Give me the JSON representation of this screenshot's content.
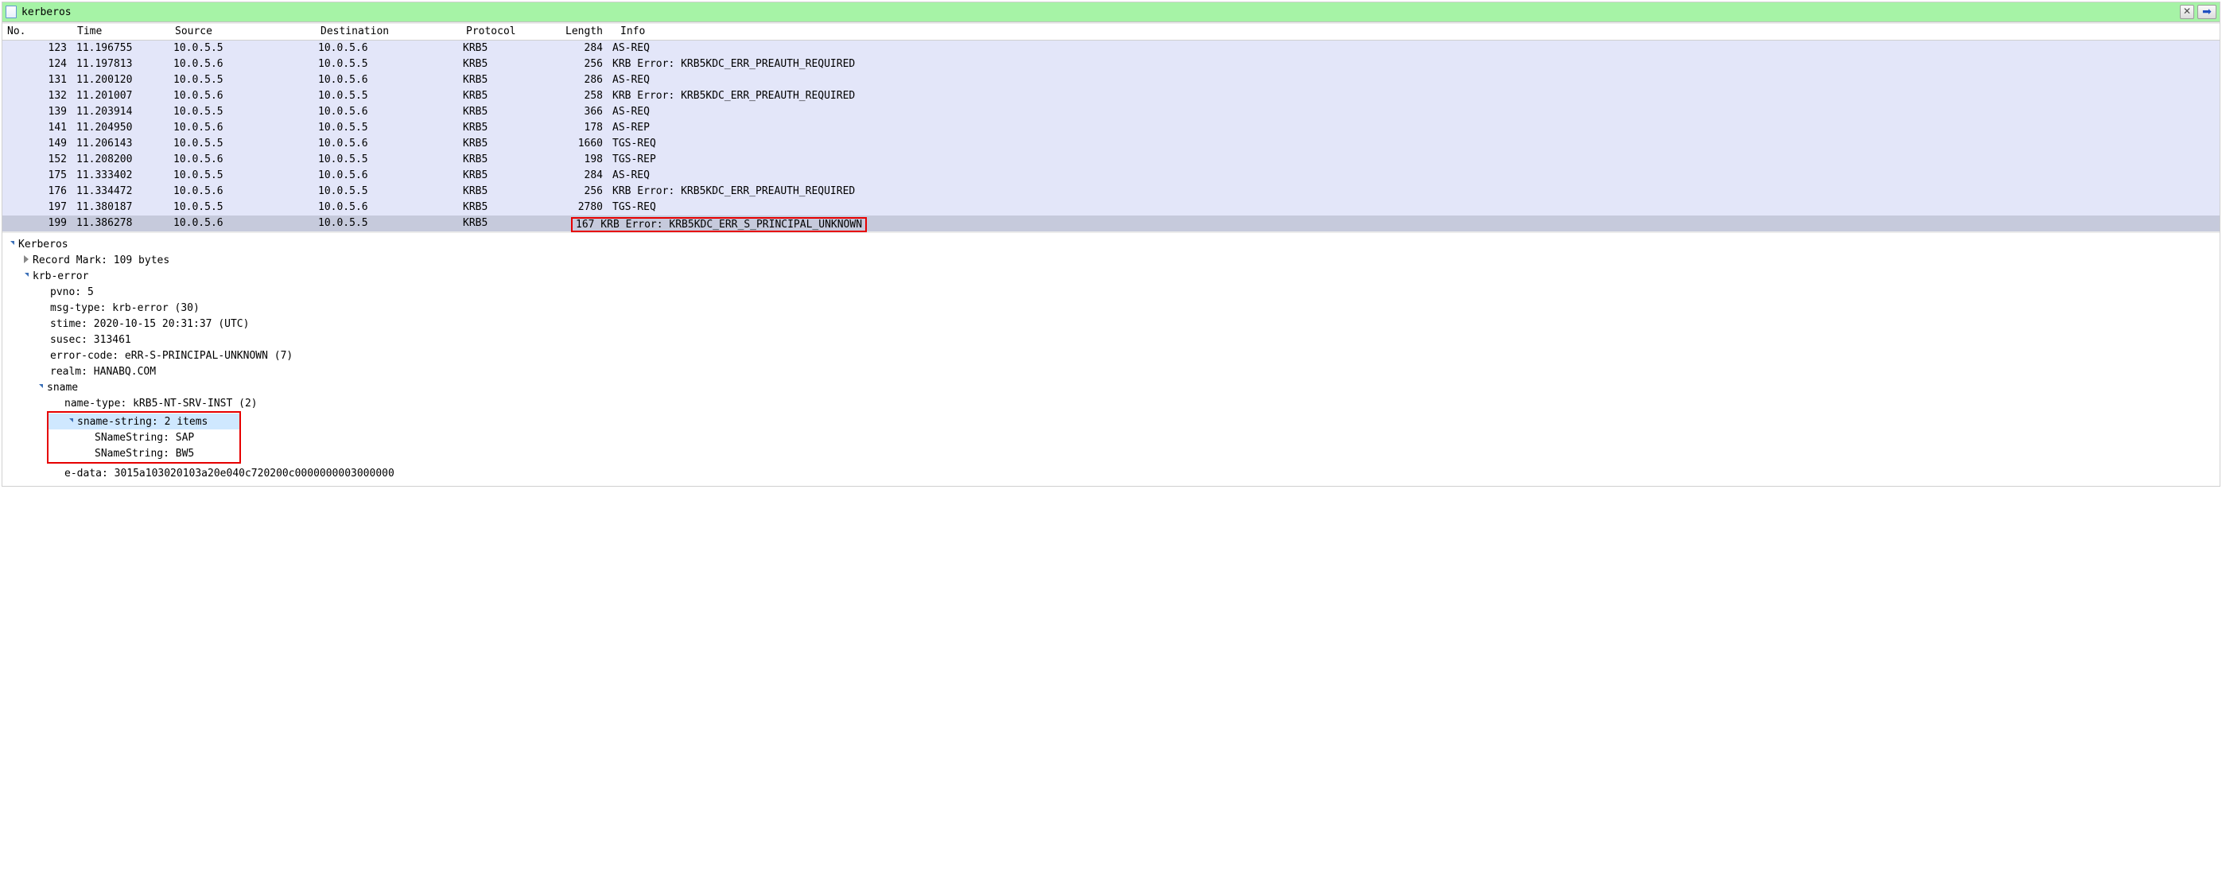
{
  "filter": {
    "value": "kerberos"
  },
  "columns": {
    "no": "No.",
    "time": "Time",
    "source": "Source",
    "destination": "Destination",
    "protocol": "Protocol",
    "length": "Length",
    "info": "Info"
  },
  "packets": [
    {
      "no": "123",
      "time": "11.196755",
      "src": "10.0.5.5",
      "dst": "10.0.5.6",
      "proto": "KRB5",
      "len": "284",
      "info": "AS-REQ"
    },
    {
      "no": "124",
      "time": "11.197813",
      "src": "10.0.5.6",
      "dst": "10.0.5.5",
      "proto": "KRB5",
      "len": "256",
      "info": "KRB Error: KRB5KDC_ERR_PREAUTH_REQUIRED"
    },
    {
      "no": "131",
      "time": "11.200120",
      "src": "10.0.5.5",
      "dst": "10.0.5.6",
      "proto": "KRB5",
      "len": "286",
      "info": "AS-REQ"
    },
    {
      "no": "132",
      "time": "11.201007",
      "src": "10.0.5.6",
      "dst": "10.0.5.5",
      "proto": "KRB5",
      "len": "258",
      "info": "KRB Error: KRB5KDC_ERR_PREAUTH_REQUIRED"
    },
    {
      "no": "139",
      "time": "11.203914",
      "src": "10.0.5.5",
      "dst": "10.0.5.6",
      "proto": "KRB5",
      "len": "366",
      "info": "AS-REQ"
    },
    {
      "no": "141",
      "time": "11.204950",
      "src": "10.0.5.6",
      "dst": "10.0.5.5",
      "proto": "KRB5",
      "len": "178",
      "info": "AS-REP"
    },
    {
      "no": "149",
      "time": "11.206143",
      "src": "10.0.5.5",
      "dst": "10.0.5.6",
      "proto": "KRB5",
      "len": "1660",
      "info": "TGS-REQ"
    },
    {
      "no": "152",
      "time": "11.208200",
      "src": "10.0.5.6",
      "dst": "10.0.5.5",
      "proto": "KRB5",
      "len": "198",
      "info": "TGS-REP"
    },
    {
      "no": "175",
      "time": "11.333402",
      "src": "10.0.5.5",
      "dst": "10.0.5.6",
      "proto": "KRB5",
      "len": "284",
      "info": "AS-REQ"
    },
    {
      "no": "176",
      "time": "11.334472",
      "src": "10.0.5.6",
      "dst": "10.0.5.5",
      "proto": "KRB5",
      "len": "256",
      "info": "KRB Error: KRB5KDC_ERR_PREAUTH_REQUIRED"
    },
    {
      "no": "197",
      "time": "11.380187",
      "src": "10.0.5.5",
      "dst": "10.0.5.6",
      "proto": "KRB5",
      "len": "2780",
      "info": "TGS-REQ"
    },
    {
      "no": "199",
      "time": "11.386278",
      "src": "10.0.5.6",
      "dst": "10.0.5.5",
      "proto": "KRB5",
      "len": "167",
      "info": "KRB Error: KRB5KDC_ERR_S_PRINCIPAL_UNKNOWN"
    }
  ],
  "details": {
    "root": "Kerberos",
    "record_mark": "Record Mark: 109 bytes",
    "krb_error_label": "krb-error",
    "pvno": "pvno: 5",
    "msg_type": "msg-type: krb-error (30)",
    "stime": "stime: 2020-10-15 20:31:37 (UTC)",
    "susec": "susec: 313461",
    "error_code": "error-code: eRR-S-PRINCIPAL-UNKNOWN (7)",
    "realm": "realm: HANABQ.COM",
    "sname_label": "sname",
    "name_type": "name-type: kRB5-NT-SRV-INST (2)",
    "sname_string": "sname-string: 2 items",
    "sname_item_0": "SNameString: SAP",
    "sname_item_1": "SNameString: BW5",
    "e_data": "e-data: 3015a103020103a20e040c720200c0000000003000000"
  },
  "icons": {
    "clear": "✕",
    "apply": "➡"
  }
}
